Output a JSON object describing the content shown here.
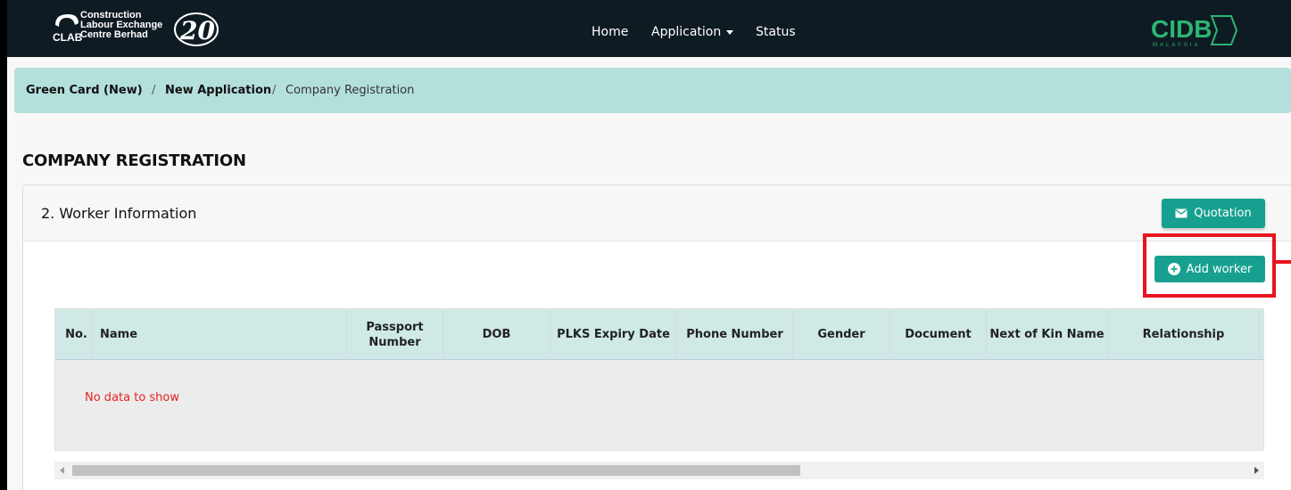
{
  "brand": {
    "org_line1": "Construction",
    "org_line2": "Labour Exchange",
    "org_line3": "Centre Berhad",
    "clab_abbr": "CLAB",
    "anniversary": "20",
    "partner_logo": "CIDB",
    "partner_sub": "MALAYSIA"
  },
  "nav": {
    "home": "Home",
    "application": "Application",
    "status": "Status"
  },
  "breadcrumb": {
    "item1": "Green Card (New)",
    "item2": "New Application",
    "item3": "Company Registration",
    "separator": "/"
  },
  "page": {
    "title": "COMPANY REGISTRATION"
  },
  "card": {
    "title": "2. Worker Information",
    "quotation_label": "Quotation",
    "add_worker_label": "Add worker"
  },
  "table": {
    "columns": [
      "No.",
      "Name",
      "Passport Number",
      "DOB",
      "PLKS Expiry Date",
      "Phone Number",
      "Gender",
      "Document",
      "Next of Kin Name",
      "Relationship"
    ],
    "empty_message": "No data to show"
  },
  "colors": {
    "nav_bg": "#0f1b22",
    "breadcrumb_bg": "#b4e0dc",
    "accent_teal": "#17a08f",
    "table_header_bg": "#cfeae6",
    "empty_text": "#e3231f",
    "highlight_red": "#e8141e"
  }
}
